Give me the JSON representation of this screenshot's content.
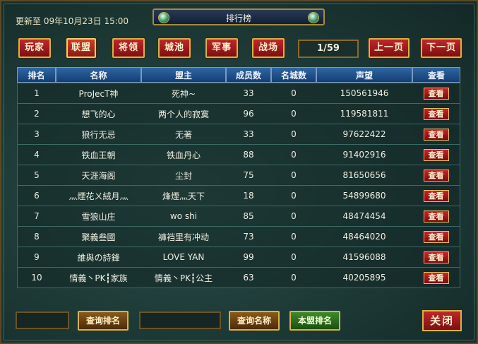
{
  "header": {
    "updated_text": "更新至 09年10月23日 15:00",
    "title": "排行榜"
  },
  "tabs": [
    {
      "label": "玩家"
    },
    {
      "label": "联盟",
      "selected": true
    },
    {
      "label": "将领"
    },
    {
      "label": "城池"
    },
    {
      "label": "军事"
    },
    {
      "label": "战场"
    }
  ],
  "pager": {
    "page": "1/59",
    "prev_label": "上一页",
    "next_label": "下一页"
  },
  "table": {
    "columns": [
      "排名",
      "名称",
      "盟主",
      "成员数",
      "名城数",
      "声望",
      "查看"
    ],
    "rows": [
      {
        "rank": "1",
        "name": "ProJecT神",
        "leader": "死神~",
        "members": "33",
        "cities": "0",
        "prestige": "150561946",
        "view": "查看"
      },
      {
        "rank": "2",
        "name": "想飞的心",
        "leader": "两个人的寂寞",
        "members": "96",
        "cities": "0",
        "prestige": "119581811",
        "view": "查看"
      },
      {
        "rank": "3",
        "name": "狼行无忌",
        "leader": "无著",
        "members": "33",
        "cities": "0",
        "prestige": "97622422",
        "view": "查看"
      },
      {
        "rank": "4",
        "name": "铁血王朝",
        "leader": "铁血丹心",
        "members": "88",
        "cities": "0",
        "prestige": "91402916",
        "view": "查看"
      },
      {
        "rank": "5",
        "name": "天涯海阁",
        "leader": "尘封",
        "members": "75",
        "cities": "0",
        "prestige": "81650656",
        "view": "查看"
      },
      {
        "rank": "6",
        "name": "灬煙花ㄨ絨月灬",
        "leader": "烽煙灬天下",
        "members": "18",
        "cities": "0",
        "prestige": "54899680",
        "view": "查看"
      },
      {
        "rank": "7",
        "name": "雪狼山庄",
        "leader": "wo shi",
        "members": "85",
        "cities": "0",
        "prestige": "48474454",
        "view": "查看"
      },
      {
        "rank": "8",
        "name": "聚義叁國",
        "leader": "褲裆里有冲动",
        "members": "73",
        "cities": "0",
        "prestige": "48464020",
        "view": "查看"
      },
      {
        "rank": "9",
        "name": "誰與の詩鋒",
        "leader": "LOVE YAN",
        "members": "99",
        "cities": "0",
        "prestige": "41596088",
        "view": "查看"
      },
      {
        "rank": "10",
        "name": "情義丶PK┇家族",
        "leader": "情義丶PK┇公主",
        "members": "63",
        "cities": "0",
        "prestige": "40205895",
        "view": "查看"
      }
    ]
  },
  "bottom": {
    "rank_query_value": "",
    "rank_query_button": "查询排名",
    "name_query_value": "",
    "name_query_button": "查询名称",
    "my_alliance_button": "本盟排名",
    "close_button": "关闭"
  },
  "colors": {
    "button_red": "#a81c20",
    "button_border_gold": "#d6b24a",
    "header_blue": "#1f4f8a",
    "panel_teal": "#1d3936"
  }
}
